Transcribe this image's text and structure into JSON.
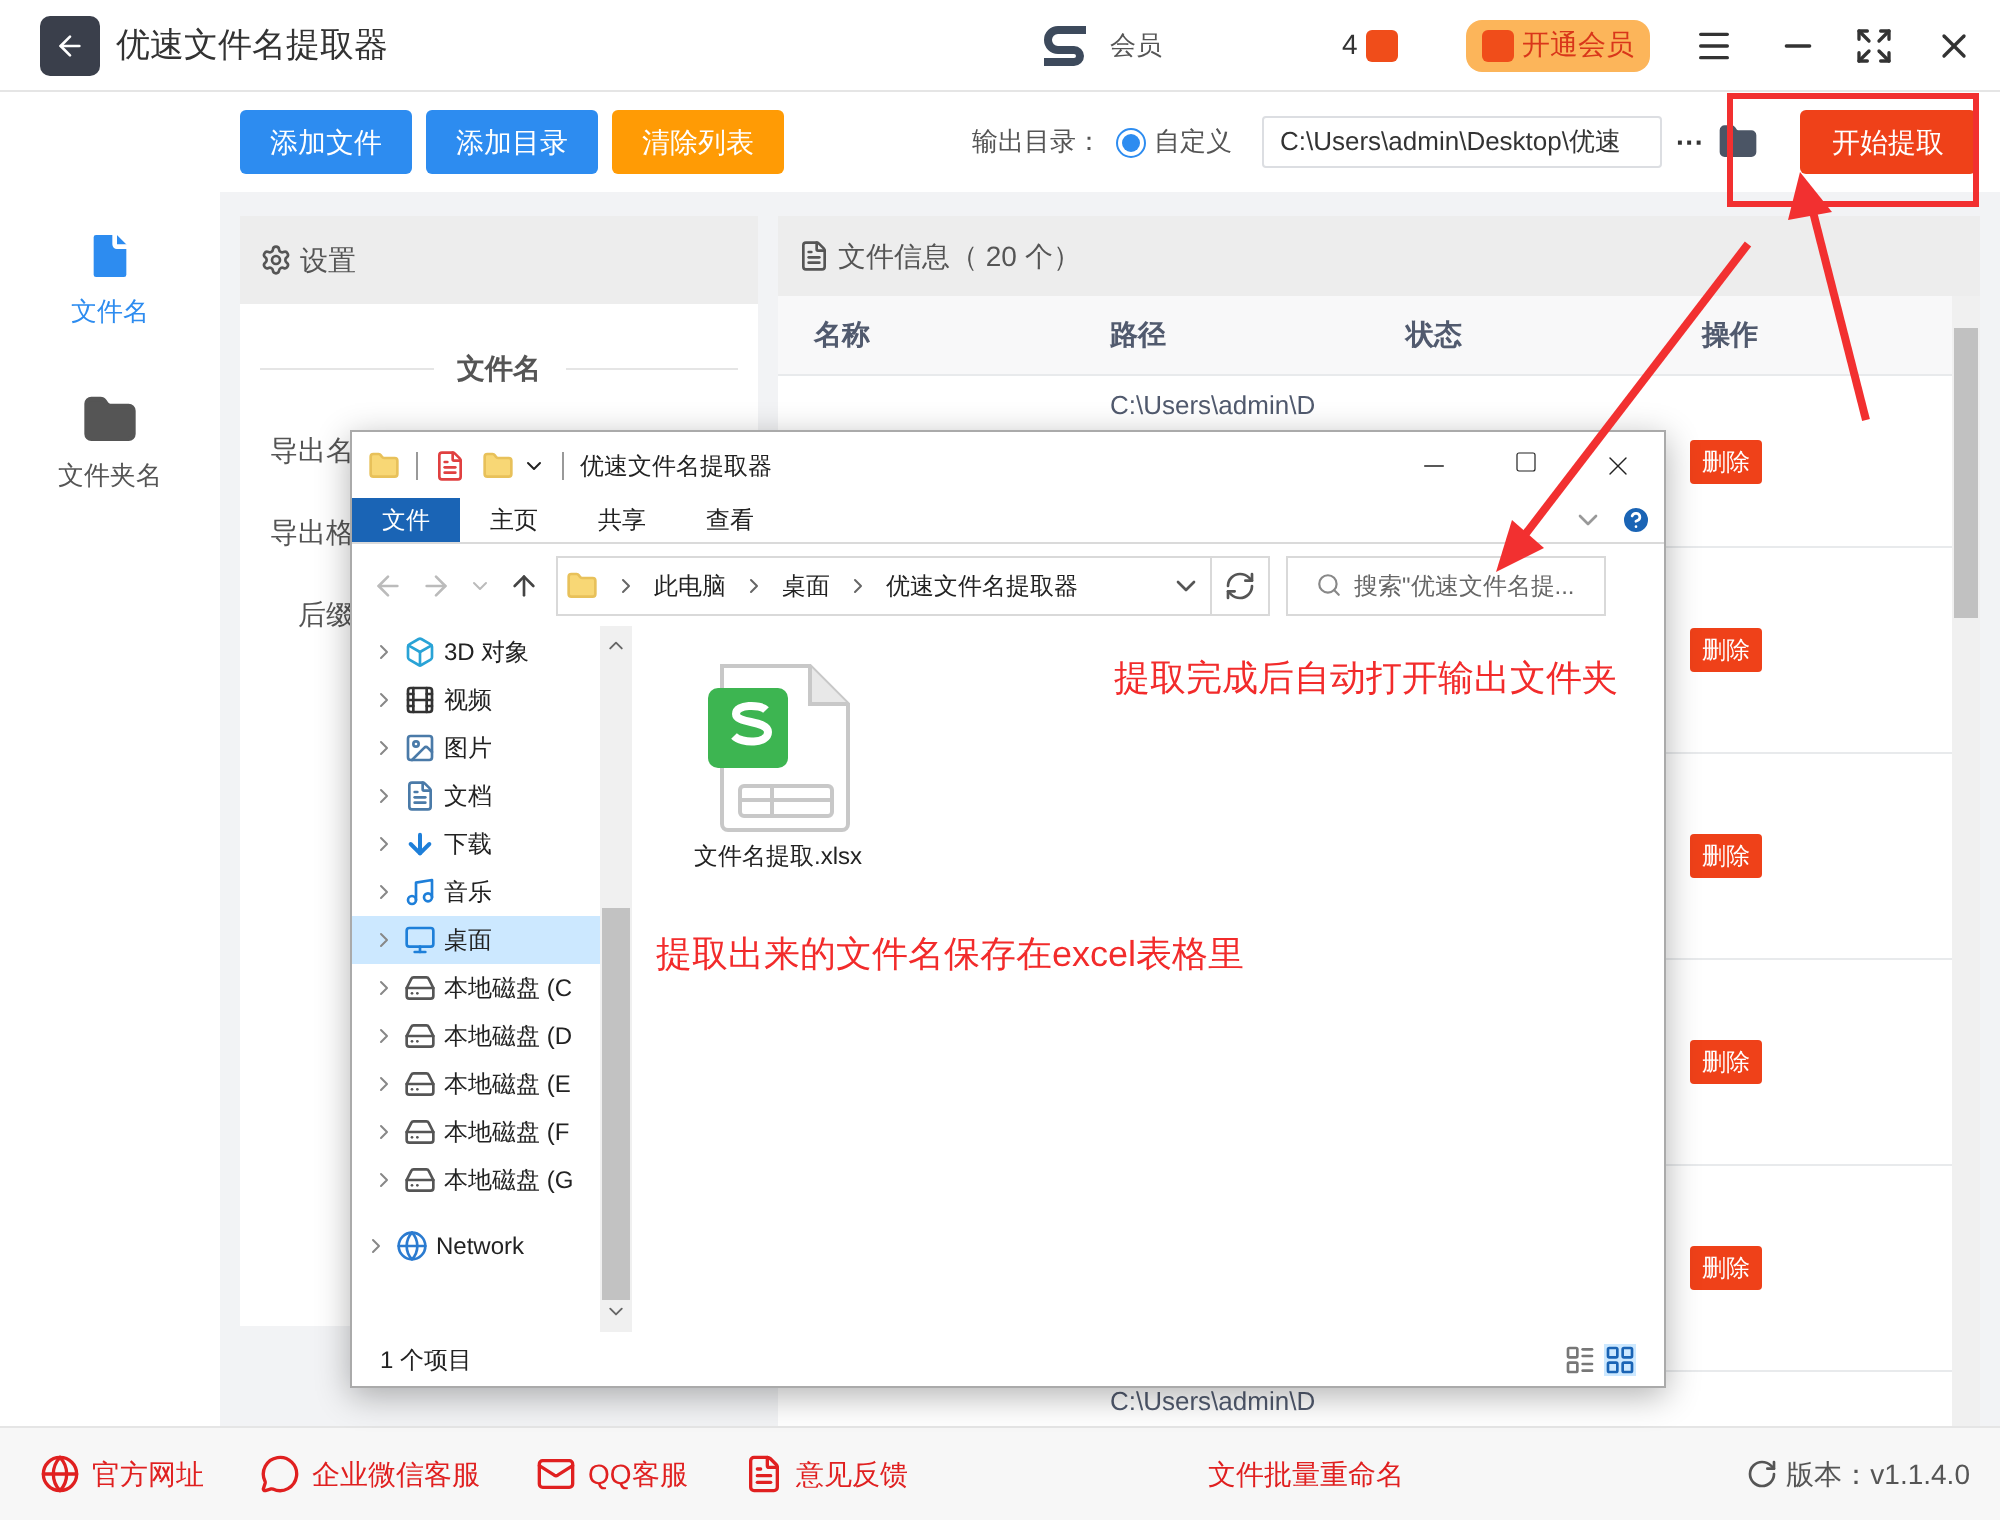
{
  "app": {
    "title": "优速文件名提取器",
    "member_label": "会员",
    "coin_count": "4",
    "vip_button": "开通会员"
  },
  "sidebar": [
    {
      "label": "文件名",
      "selected": true,
      "kind": "file"
    },
    {
      "label": "文件夹名",
      "selected": false,
      "kind": "folder"
    }
  ],
  "toolbar": {
    "buttons": [
      {
        "label": "添加文件",
        "kind": "primary"
      },
      {
        "label": "添加目录",
        "kind": "primary"
      },
      {
        "label": "清除列表",
        "kind": "warning"
      }
    ],
    "output_label": "输出目录：",
    "radio": {
      "label": "自定义",
      "selected": true
    },
    "path": "C:\\Users\\admin\\Desktop\\优速",
    "more": "···",
    "start_button": "开始提取"
  },
  "settings": {
    "title": "设置",
    "section": "文件名",
    "labels": [
      "导出名",
      "导出格",
      "后缀"
    ]
  },
  "file_info": {
    "title": "文件信息（ 20 个）",
    "columns": [
      "名称",
      "路径",
      "状态",
      "操作"
    ],
    "rows": [
      {
        "path": "C:\\Users\\admin\\D",
        "action": "删除"
      },
      {
        "action": "删除"
      },
      {
        "action": "删除"
      },
      {
        "action": "删除"
      },
      {
        "action": "删除"
      },
      {
        "path": "C:\\Users\\admin\\D"
      }
    ]
  },
  "explorer": {
    "title": "优速文件名提取器",
    "tabs": [
      {
        "label": "文件",
        "selected": true
      },
      {
        "label": "主页",
        "selected": false
      },
      {
        "label": "共享",
        "selected": false
      },
      {
        "label": "查看",
        "selected": false
      }
    ],
    "breadcrumb": [
      "此电脑",
      "桌面",
      "优速文件名提取器"
    ],
    "search": {
      "placeholder": "搜索\"优速文件名提..."
    },
    "nav": [
      {
        "label": "3D 对象",
        "kind": "cube",
        "selected": false
      },
      {
        "label": "视频",
        "kind": "video",
        "selected": false
      },
      {
        "label": "图片",
        "kind": "picture",
        "selected": false
      },
      {
        "label": "文档",
        "kind": "document",
        "selected": false
      },
      {
        "label": "下载",
        "kind": "download",
        "selected": false
      },
      {
        "label": "音乐",
        "kind": "music",
        "selected": false
      },
      {
        "label": "桌面",
        "kind": "desktop",
        "selected": true
      },
      {
        "label": "本地磁盘 (C",
        "kind": "system-drive",
        "selected": false
      },
      {
        "label": "本地磁盘 (D",
        "kind": "drive",
        "selected": false
      },
      {
        "label": "本地磁盘 (E",
        "kind": "drive",
        "selected": false
      },
      {
        "label": "本地磁盘 (F",
        "kind": "drive",
        "selected": false
      },
      {
        "label": "本地磁盘 (G",
        "kind": "drive",
        "selected": false
      },
      {
        "label": "Network",
        "kind": "network",
        "selected": false
      }
    ],
    "file": {
      "name": "文件名提取.xlsx"
    },
    "status": "1 个项目"
  },
  "annotations": [
    "提取完成后自动打开输出文件夹",
    "提取出来的文件名保存在excel表格里"
  ],
  "footer": {
    "links": [
      {
        "label": "官方网址",
        "kind": "web"
      },
      {
        "label": "企业微信客服",
        "kind": "wechat"
      },
      {
        "label": "QQ客服",
        "kind": "qq"
      },
      {
        "label": "意见反馈",
        "kind": "feedback"
      }
    ],
    "center": "文件批量重命名",
    "version": "版本：v1.1.4.0"
  }
}
